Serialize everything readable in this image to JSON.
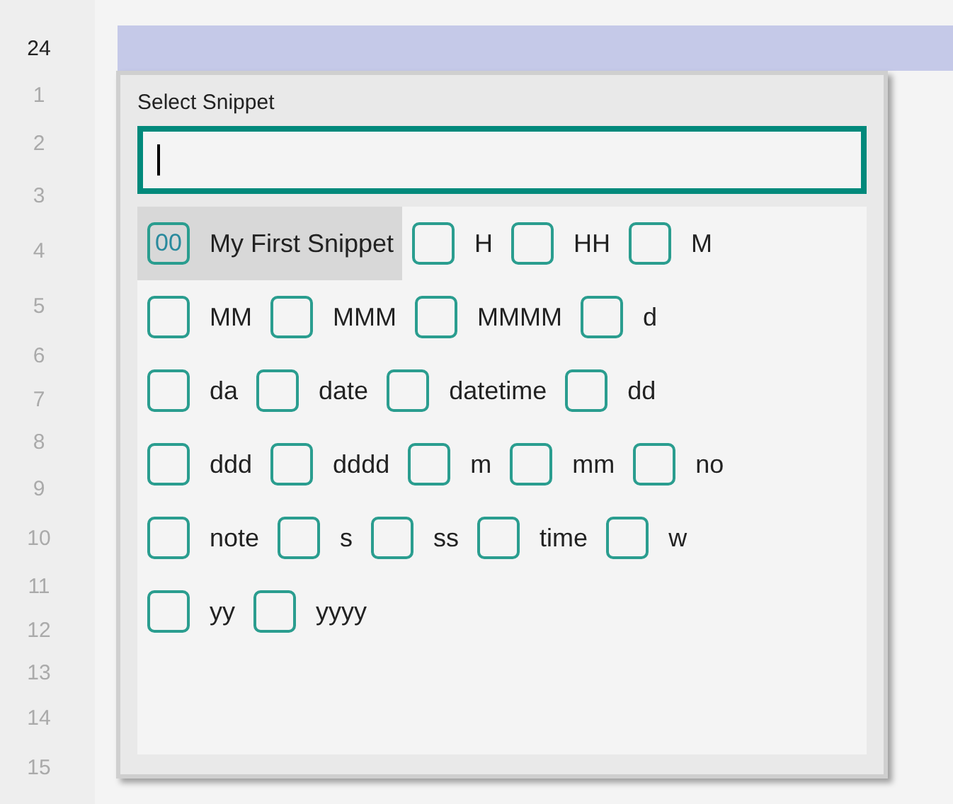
{
  "gutter": {
    "line_numbers": [
      {
        "text": "24",
        "current": true
      },
      {
        "text": "1",
        "current": false
      },
      {
        "text": "2",
        "current": false
      },
      {
        "text": "3",
        "current": false
      },
      {
        "text": "4",
        "current": false
      },
      {
        "text": "5",
        "current": false
      },
      {
        "text": "6",
        "current": false
      },
      {
        "text": "7",
        "current": false
      },
      {
        "text": "8",
        "current": false
      },
      {
        "text": "9",
        "current": false
      },
      {
        "text": "10",
        "current": false
      },
      {
        "text": "11",
        "current": false
      },
      {
        "text": "12",
        "current": false
      },
      {
        "text": "13",
        "current": false
      },
      {
        "text": "14",
        "current": false
      },
      {
        "text": "15",
        "current": false
      }
    ]
  },
  "popup": {
    "title": "Select Snippet",
    "rows": [
      {
        "snippets": [
          {
            "key": "00",
            "label": "My First Snippet",
            "selected": true
          },
          {
            "label": "H",
            "selected": false
          },
          {
            "label": "HH",
            "selected": false
          },
          {
            "label": "M",
            "selected": false
          }
        ]
      },
      {
        "snippets": [
          {
            "label": "MM",
            "selected": false
          },
          {
            "label": "MMM",
            "selected": false
          },
          {
            "label": "MMMM",
            "selected": false
          },
          {
            "label": "d",
            "selected": false
          }
        ]
      },
      {
        "snippets": [
          {
            "label": "da",
            "selected": false
          },
          {
            "label": "date",
            "selected": false
          },
          {
            "label": "datetime",
            "selected": false
          },
          {
            "label": "dd",
            "selected": false
          }
        ]
      },
      {
        "snippets": [
          {
            "label": "ddd",
            "selected": false
          },
          {
            "label": "dddd",
            "selected": false
          },
          {
            "label": "m",
            "selected": false
          },
          {
            "label": "mm",
            "selected": false
          },
          {
            "label": "no",
            "selected": false
          }
        ]
      },
      {
        "snippets": [
          {
            "label": "note",
            "selected": false
          },
          {
            "label": "s",
            "selected": false
          },
          {
            "label": "ss",
            "selected": false
          },
          {
            "label": "time",
            "selected": false
          },
          {
            "label": "w",
            "selected": false
          }
        ]
      },
      {
        "snippets": [
          {
            "label": "yy",
            "selected": false
          },
          {
            "label": "yyyy",
            "selected": false
          }
        ]
      }
    ]
  }
}
